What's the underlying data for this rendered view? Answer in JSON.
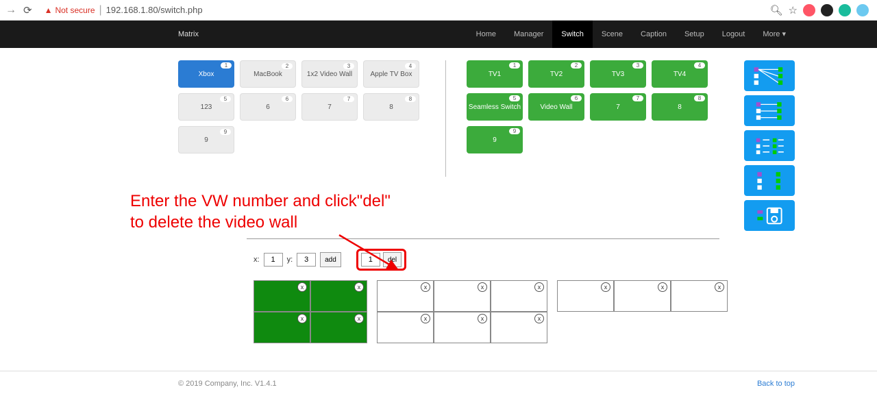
{
  "browser": {
    "not_secure": "Not secure",
    "url": "192.168.1.80/switch.php"
  },
  "nav": {
    "brand": "Matrix",
    "items": [
      "Home",
      "Manager",
      "Switch",
      "Scene",
      "Caption",
      "Setup",
      "Logout",
      "More ▾"
    ],
    "active_index": 2
  },
  "inputs": [
    {
      "id": 1,
      "label": "Xbox",
      "active": true
    },
    {
      "id": 2,
      "label": "MacBook",
      "active": false
    },
    {
      "id": 3,
      "label": "1x2 Video Wall",
      "active": false
    },
    {
      "id": 4,
      "label": "Apple TV Box",
      "active": false
    },
    {
      "id": 5,
      "label": "123",
      "active": false
    },
    {
      "id": 6,
      "label": "6",
      "active": false
    },
    {
      "id": 7,
      "label": "7",
      "active": false
    },
    {
      "id": 8,
      "label": "8",
      "active": false
    },
    {
      "id": 9,
      "label": "9",
      "active": false
    }
  ],
  "outputs": [
    {
      "id": 1,
      "label": "TV1"
    },
    {
      "id": 2,
      "label": "TV2"
    },
    {
      "id": 3,
      "label": "TV3"
    },
    {
      "id": 4,
      "label": "TV4"
    },
    {
      "id": 5,
      "label": "Seamless Switch"
    },
    {
      "id": 6,
      "label": "Video Wall"
    },
    {
      "id": 7,
      "label": "7"
    },
    {
      "id": 8,
      "label": "8"
    },
    {
      "id": 9,
      "label": "9"
    }
  ],
  "annotation": {
    "line1": "Enter the VW number and click\"del\"",
    "line2": "to delete the video wall"
  },
  "controls": {
    "x_label": "x:",
    "x_value": "1",
    "y_label": "y:",
    "y_value": "3",
    "add_label": "add",
    "del_value": "1",
    "del_label": "del"
  },
  "video_walls": [
    {
      "rows": 2,
      "cols": 2,
      "filled": true
    },
    {
      "rows": 2,
      "cols": 3,
      "filled": false
    },
    {
      "rows": 1,
      "cols": 3,
      "filled": false
    }
  ],
  "footer": {
    "copyright": "© 2019 Company, Inc. V1.4.1",
    "back": "Back to top"
  }
}
